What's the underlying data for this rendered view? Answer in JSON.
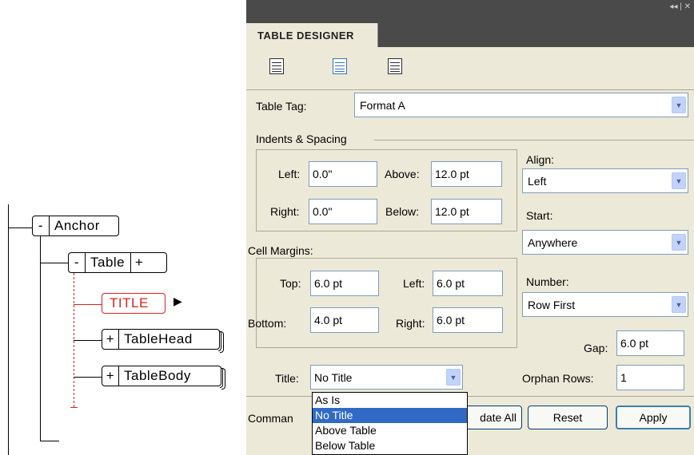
{
  "tree": {
    "nodes": [
      {
        "key": "anchor",
        "toggle": "-",
        "label": "Anchor"
      },
      {
        "key": "table",
        "toggle": "-",
        "label": "Table",
        "toggle_right": "+"
      },
      {
        "key": "title",
        "label": "TITLE",
        "marker": "▶"
      },
      {
        "key": "tablehead",
        "toggle": "+",
        "label": "TableHead"
      },
      {
        "key": "tablebody",
        "toggle": "+",
        "label": "TableBody"
      }
    ]
  },
  "panel": {
    "controls": "◂◂ | ✕",
    "tab_label": "TABLE DESIGNER",
    "icons": [
      "table-basic-icon",
      "table-ruling-icon",
      "table-shading-icon"
    ],
    "table_tag": {
      "label": "Table Tag:",
      "value": "Format A"
    },
    "indents_spacing": {
      "heading": "Indents & Spacing",
      "left": {
        "label": "Left:",
        "value": "0.0\""
      },
      "right": {
        "label": "Right:",
        "value": "0.0\""
      },
      "above": {
        "label": "Above:",
        "value": "12.0 pt"
      },
      "below": {
        "label": "Below:",
        "value": "12.0 pt"
      }
    },
    "cell_margins": {
      "heading": "Cell Margins:",
      "top": {
        "label": "Top:",
        "value": "6.0 pt"
      },
      "bottom": {
        "label": "Bottom:",
        "value": "4.0 pt"
      },
      "left": {
        "label": "Left:",
        "value": "6.0 pt"
      },
      "right": {
        "label": "Right:",
        "value": "6.0 pt"
      }
    },
    "align": {
      "label": "Align:",
      "value": "Left"
    },
    "start": {
      "label": "Start:",
      "value": "Anywhere"
    },
    "number": {
      "label": "Number:",
      "value": "Row First"
    },
    "gap": {
      "label": "Gap:",
      "value": "6.0 pt"
    },
    "title": {
      "label": "Title:",
      "value": "No Title",
      "options": [
        "As Is",
        "No Title",
        "Above Table",
        "Below Table"
      ],
      "selected_index": 1
    },
    "orphan_rows": {
      "label": "Orphan Rows:",
      "value": "1"
    },
    "commands_label": "Comman",
    "update_all_label": "date All",
    "reset_label": "Reset",
    "apply_label": "Apply"
  }
}
